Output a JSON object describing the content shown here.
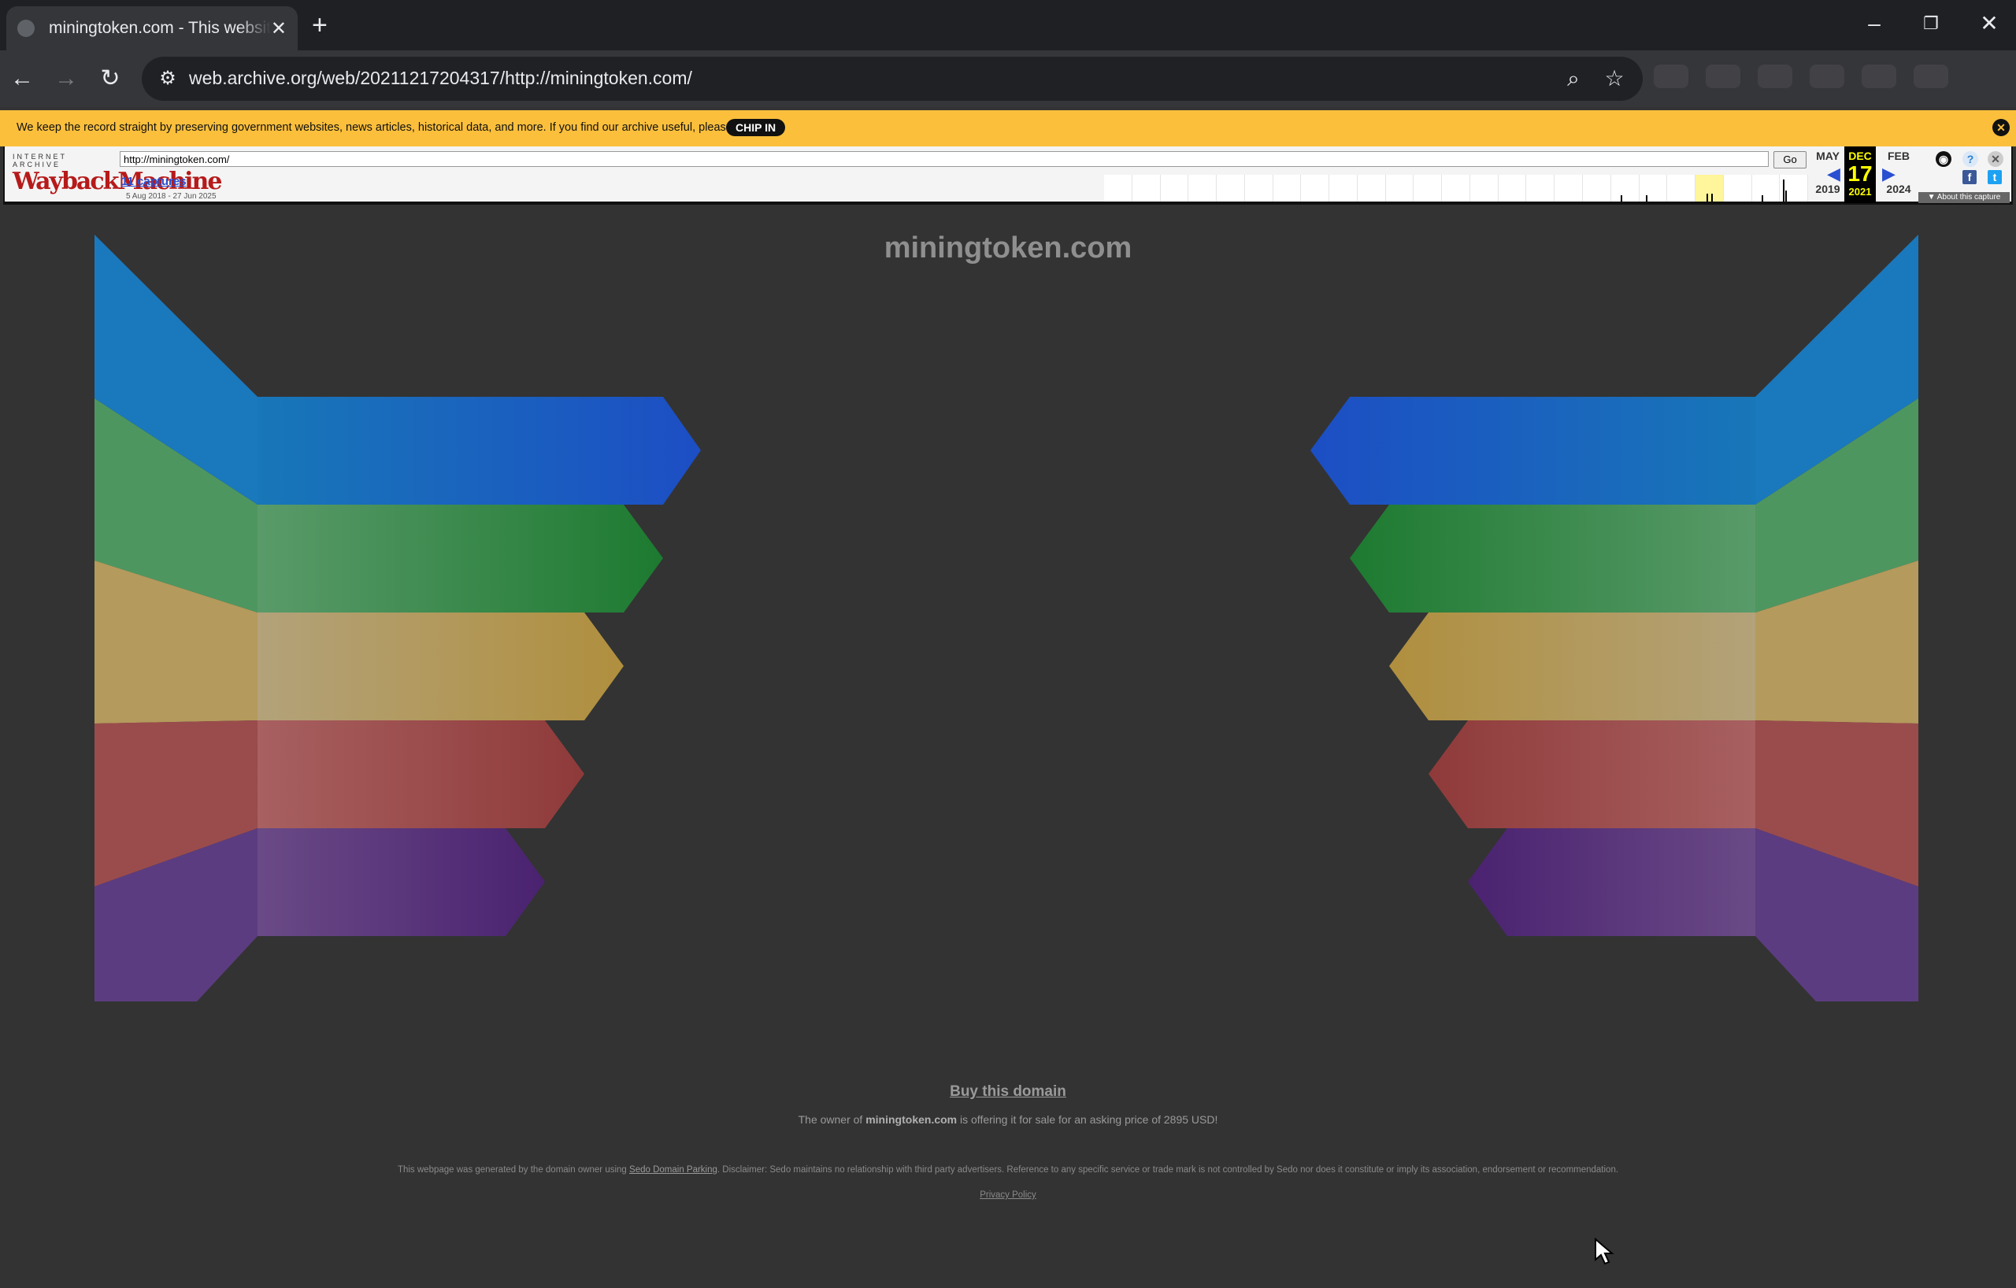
{
  "browser": {
    "tab_title": "miningtoken.com - This website is for sale",
    "new_tab_icon": "plus-icon",
    "url": "web.archive.org/web/20211217204317/http://miningtoken.com/"
  },
  "banner": {
    "text": "We keep the record straight by preserving government websites, news articles, historical data, and more. If you find our archive useful, please",
    "chip_label": "CHIP IN",
    "color": "#fbbf3c"
  },
  "wayback": {
    "ia_label": "INTERNET ARCHIVE",
    "logo_text": "WaybackMachine",
    "url_value": "http://miningtoken.com/",
    "go_label": "Go",
    "captures_label": "11 captures",
    "date_range": "5 Aug 2018 - 27 Jun 2025",
    "prev": {
      "month": "MAY",
      "year": "2019"
    },
    "current": {
      "month": "DEC",
      "day": "17",
      "year": "2021"
    },
    "next": {
      "month": "FEB",
      "year": "2024"
    },
    "about_label": "▼ About this capture"
  },
  "page": {
    "title": "miningtoken.com",
    "buy_link": "Buy this domain",
    "offer_prefix": "The owner of",
    "offer_domain": "miningtoken.com",
    "offer_suffix": "is offering it for sale for an asking price of 2895 USD!",
    "disclaimer_prefix": "This webpage was generated by the domain owner using",
    "disclaimer_link": "Sedo Domain Parking",
    "disclaimer_suffix": ". Disclaimer: Sedo maintains no relationship with third party advertisers. Reference to any specific service or trade mark is not controlled by Sedo nor does it constitute or imply its association, endorsement or recommendation.",
    "privacy_link": "Privacy Policy",
    "art_colors": [
      "#1a6fc0",
      "#2e8b3d",
      "#b89a5a",
      "#9a4a4a",
      "#5a3a7a"
    ]
  }
}
